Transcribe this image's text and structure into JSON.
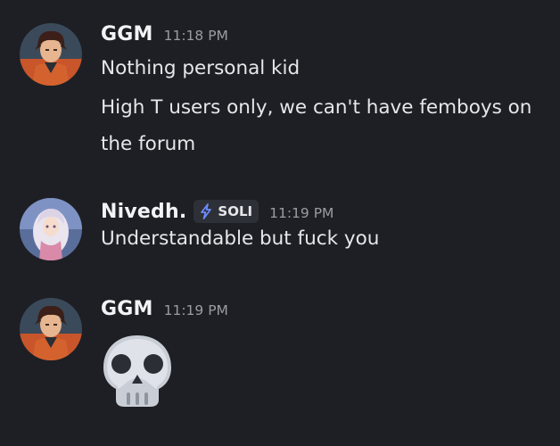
{
  "messages": [
    {
      "username": "GGM",
      "time": "11:18 PM",
      "lines": [
        "Nothing personal kid",
        "High T users only, we can't have femboys on the forum"
      ]
    },
    {
      "username": "Nivedh.",
      "tag": {
        "icon": "lightning-icon",
        "label": "SOLI"
      },
      "time": "11:19 PM",
      "lines": [
        "Understandable but fuck you"
      ]
    },
    {
      "username": "GGM",
      "time": "11:19 PM",
      "emoji": "skull-icon"
    }
  ],
  "colors": {
    "background": "#1e1f24",
    "username": "#f2f3f5",
    "timestamp": "#9a9ca3",
    "tag_accent": "#6b8cff"
  }
}
